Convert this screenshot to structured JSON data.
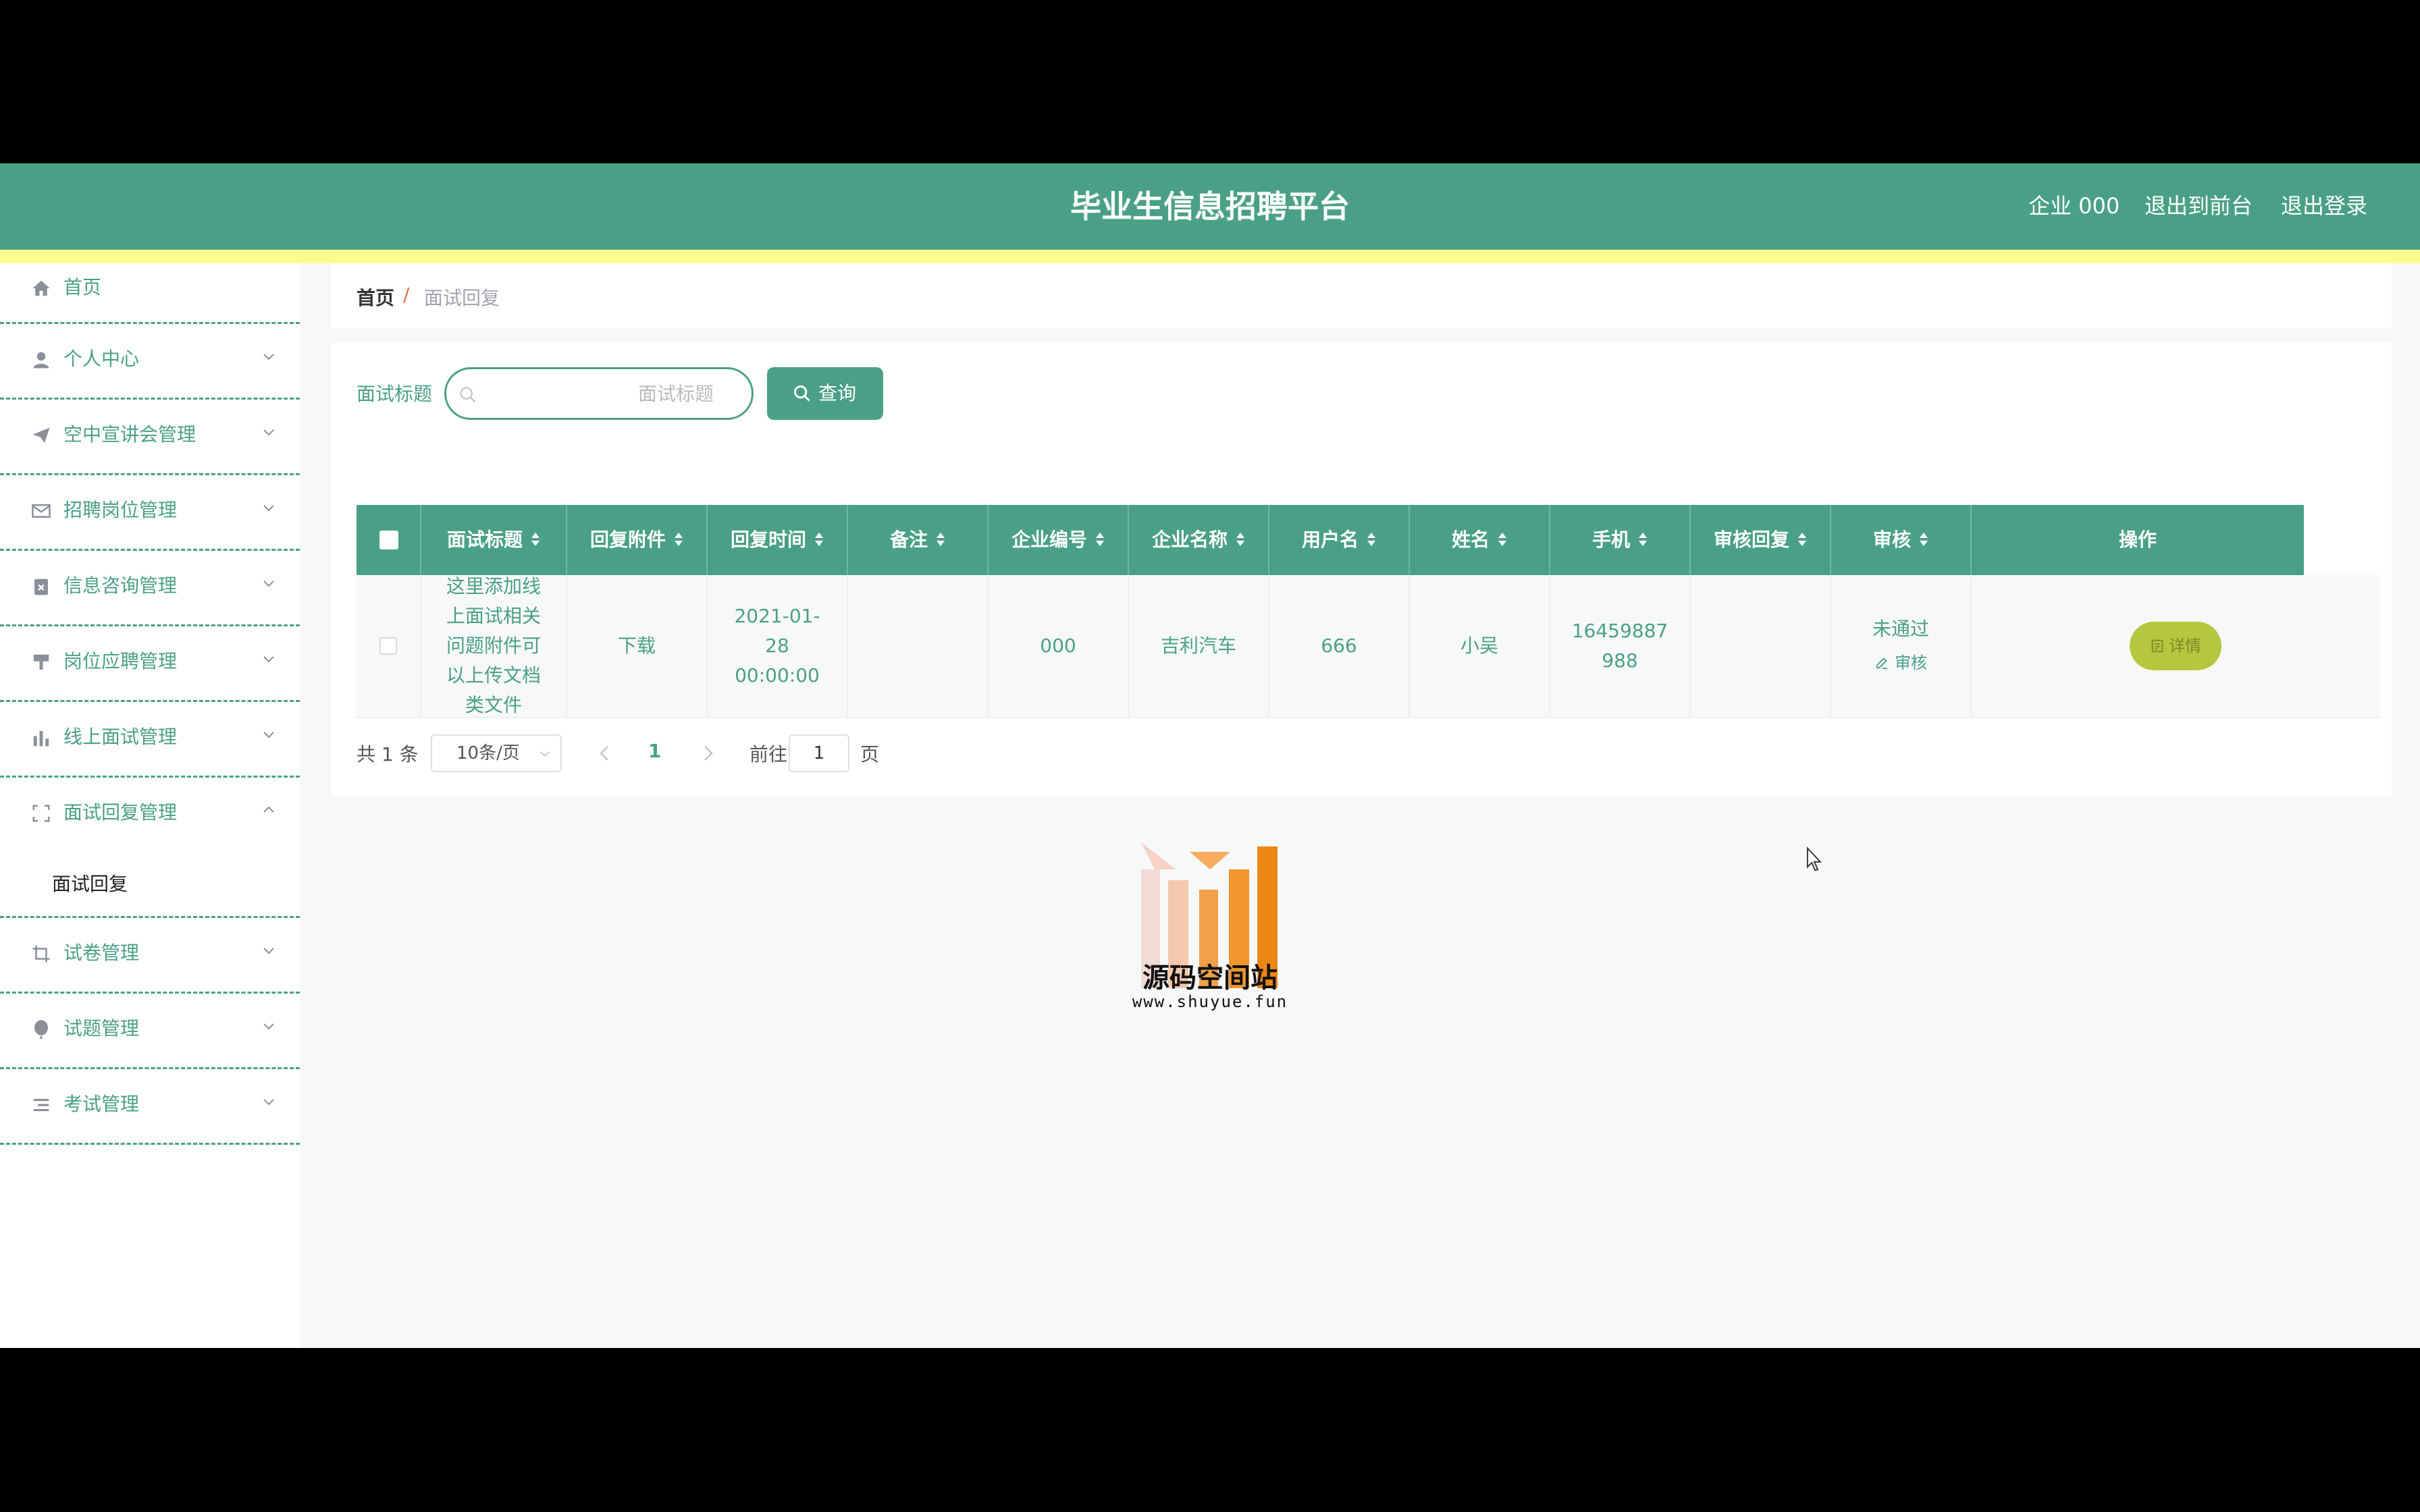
{
  "header": {
    "title": "毕业生信息招聘平台",
    "user": "企业 000",
    "to_front": "退出到前台",
    "logout": "退出登录"
  },
  "sidebar": {
    "items": [
      {
        "label": "首页",
        "icon": "home-icon"
      },
      {
        "label": "个人中心",
        "icon": "user-icon"
      },
      {
        "label": "空中宣讲会管理",
        "icon": "paper-plane-icon"
      },
      {
        "label": "招聘岗位管理",
        "icon": "mail-icon"
      },
      {
        "label": "信息咨询管理",
        "icon": "clipboard-x-icon"
      },
      {
        "label": "岗位应聘管理",
        "icon": "brush-icon"
      },
      {
        "label": "线上面试管理",
        "icon": "bar-chart-icon"
      },
      {
        "label": "面试回复管理",
        "icon": "scan-icon",
        "sub": "面试回复"
      },
      {
        "label": "试卷管理",
        "icon": "crop-icon"
      },
      {
        "label": "试题管理",
        "icon": "balloon-icon"
      },
      {
        "label": "考试管理",
        "icon": "list-icon"
      }
    ]
  },
  "breadcrumb": {
    "home": "首页",
    "separator": "/",
    "current": "面试回复"
  },
  "search": {
    "label": "面试标题",
    "placeholder": "面试标题",
    "button": "查询"
  },
  "table": {
    "columns": [
      "面试标题",
      "回复附件",
      "回复时间",
      "备注",
      "企业编号",
      "企业名称",
      "用户名",
      "姓名",
      "手机",
      "审核回复",
      "审核",
      "操作"
    ],
    "rows": [
      {
        "title": "这里添加线上面试相关问题附件可以上传文档类文件",
        "attachment": "下载",
        "time": "2021-01-28 00:00:00",
        "note": "",
        "company_no": "000",
        "company_name": "吉利汽车",
        "username": "666",
        "name": "小吴",
        "phone": "16459887988",
        "audit_reply": "",
        "audit_status": "未通过",
        "audit_action": "审核",
        "detail": "详情"
      }
    ]
  },
  "pagination": {
    "total": "共 1 条",
    "page_size": "10条/页",
    "current": "1",
    "goto": "前往",
    "jump_value": "1",
    "suffix": "页"
  },
  "watermark": {
    "name": "源码空间站",
    "url": "www.shuyue.fun"
  },
  "colors": {
    "primary": "#4aa086",
    "accent_bar": "#fafc90",
    "detail_button": "#b4c73e"
  }
}
